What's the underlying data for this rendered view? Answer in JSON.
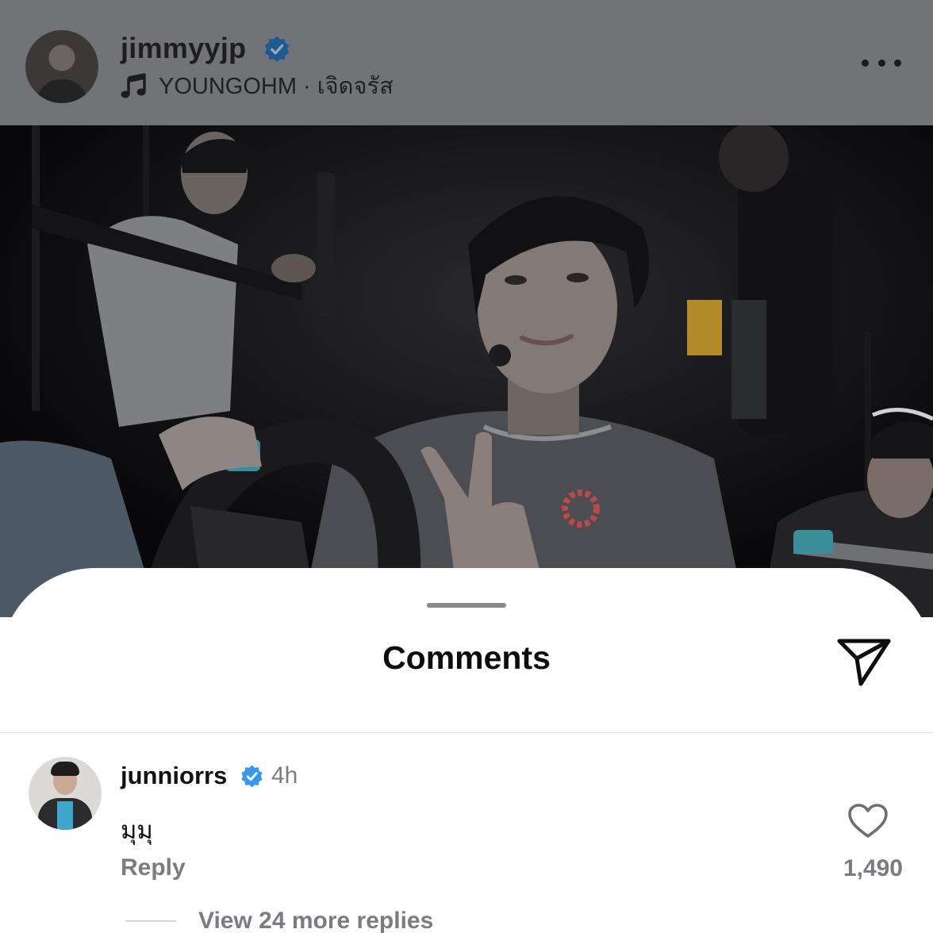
{
  "post": {
    "username": "jimmyyjp",
    "verified": true,
    "music": {
      "icon": "music-note-icon",
      "text": "YOUNGOHM · เจิดจรัส"
    },
    "more_icon": "more-horizontal-icon"
  },
  "comments_sheet": {
    "title": "Comments",
    "share_icon": "send-icon"
  },
  "comments": [
    {
      "username": "junniorrs",
      "verified": true,
      "time": "4h",
      "text": "มุมุ",
      "reply_label": "Reply",
      "likes": "1,490",
      "view_replies_label": "View 24 more replies"
    }
  ],
  "colors": {
    "dim_overlay": "#727377",
    "verified_badge": "#3897f0",
    "secondary_text": "#7b7c82",
    "accent_teal": "#3ea6c9"
  }
}
